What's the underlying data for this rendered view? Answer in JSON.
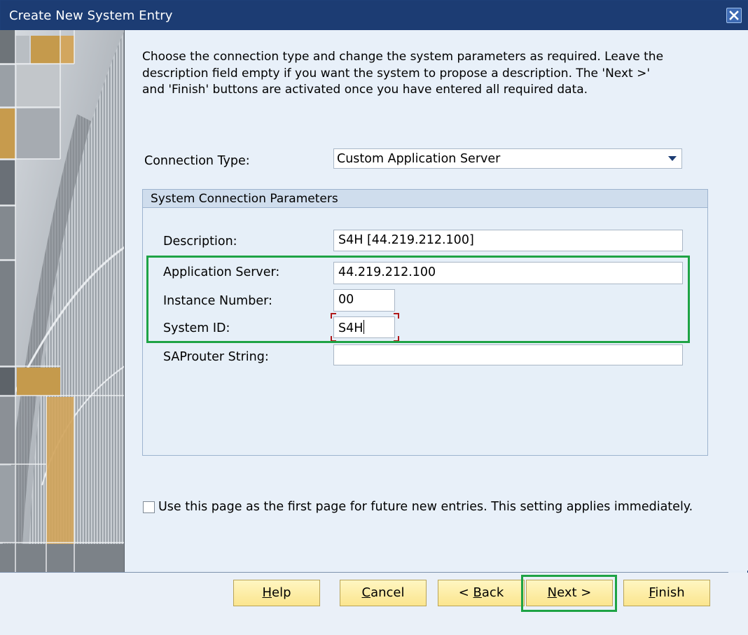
{
  "window": {
    "title": "Create New System Entry"
  },
  "instructions": "Choose the connection type and change the system parameters as required. Leave the description field empty if you want the system to propose a description. The 'Next >' and 'Finish' buttons are activated once you have entered all required data.",
  "connection": {
    "label": "Connection Type:",
    "value": "Custom Application Server"
  },
  "group": {
    "title": "System Connection Parameters",
    "description": {
      "label": "Description:",
      "value": "S4H [44.219.212.100]"
    },
    "app_server": {
      "label": "Application Server:",
      "value": "44.219.212.100"
    },
    "instance": {
      "label": "Instance Number:",
      "value": "00"
    },
    "system_id": {
      "label": "System ID:",
      "value": "S4H"
    },
    "saprouter": {
      "label": "SAProuter String:",
      "value": ""
    }
  },
  "checkbox": {
    "label": "Use this page as the first page for future new entries. This setting applies immediately.",
    "checked": false
  },
  "buttons": {
    "help": {
      "pre": "",
      "mn": "H",
      "post": "elp"
    },
    "cancel": {
      "pre": "",
      "mn": "C",
      "post": "ancel"
    },
    "back": {
      "pre": "< ",
      "mn": "B",
      "post": "ack"
    },
    "next": {
      "pre": "",
      "mn": "N",
      "post": "ext >"
    },
    "finish": {
      "pre": "",
      "mn": "F",
      "post": "inish"
    }
  },
  "colors": {
    "titlebar": "#1c3c73",
    "highlight": "#1ea345",
    "button": "#fbe58e"
  },
  "icons": {
    "close": "close-icon",
    "dropdown": "chevron-down-icon"
  }
}
